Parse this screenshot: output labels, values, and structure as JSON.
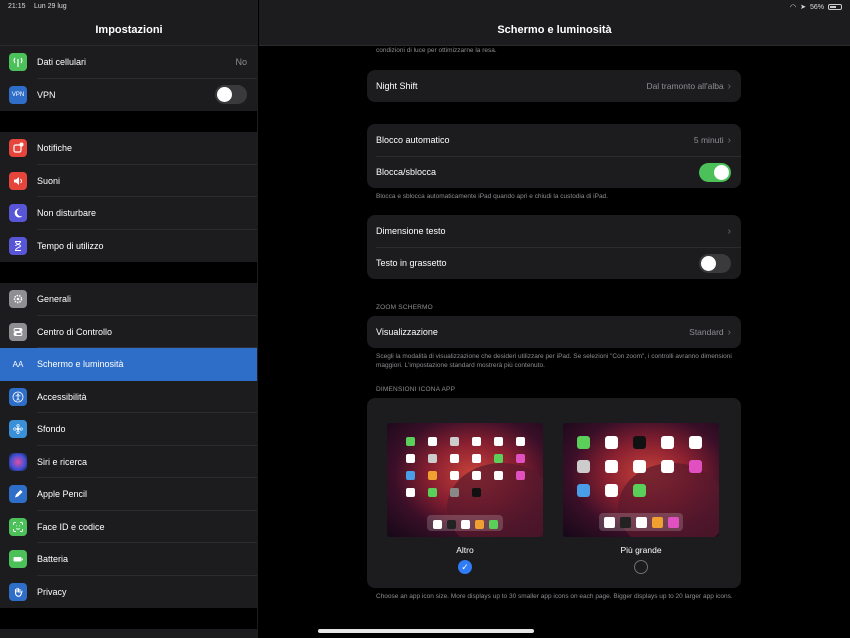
{
  "status": {
    "time": "21:15",
    "date": "Lun 29 lug",
    "battery": "56%"
  },
  "sidebar": {
    "title": "Impostazioni",
    "group1": [
      {
        "label": "Dati cellulari",
        "value": "No",
        "icon": "antenna-icon",
        "color": "#4cc15a"
      },
      {
        "label": "VPN",
        "icon": "vpn-icon",
        "color": "#2f6ec8",
        "toggle": false
      }
    ],
    "group2": [
      {
        "label": "Notifiche",
        "icon": "bell-icon",
        "color": "#e5453a"
      },
      {
        "label": "Suoni",
        "icon": "speaker-icon",
        "color": "#e5453a"
      },
      {
        "label": "Non disturbare",
        "icon": "moon-icon",
        "color": "#5856d6"
      },
      {
        "label": "Tempo di utilizzo",
        "icon": "hourglass-icon",
        "color": "#5856d6"
      }
    ],
    "group3": [
      {
        "label": "Generali",
        "icon": "gear-icon",
        "color": "#8e8e93"
      },
      {
        "label": "Centro di Controllo",
        "icon": "switches-icon",
        "color": "#8e8e93"
      },
      {
        "label": "Schermo e luminosità",
        "icon": "text-size-icon",
        "color": "#2f6ec8",
        "selected": true
      },
      {
        "label": "Accessibilità",
        "icon": "accessibility-icon",
        "color": "#2f6ec8"
      },
      {
        "label": "Sfondo",
        "icon": "flower-icon",
        "color": "#3a8fd9"
      },
      {
        "label": "Siri e ricerca",
        "icon": "siri-icon",
        "color": "#222"
      },
      {
        "label": "Apple Pencil",
        "icon": "pencil-icon",
        "color": "#2f6ec8"
      },
      {
        "label": "Face ID e codice",
        "icon": "face-id-icon",
        "color": "#4cc15a"
      },
      {
        "label": "Batteria",
        "icon": "battery-icon",
        "color": "#4cc15a"
      },
      {
        "label": "Privacy",
        "icon": "hand-icon",
        "color": "#2f6ec8"
      }
    ]
  },
  "detail": {
    "title": "Schermo e luminosità",
    "top_note": "condizioni di luce per ottimizzarne la resa.",
    "night_shift": {
      "label": "Night Shift",
      "value": "Dal tramonto all'alba"
    },
    "lock": {
      "auto_label": "Blocco automatico",
      "auto_value": "5 minuti",
      "lock_label": "Blocca/sblocca",
      "lock_on": true,
      "note": "Blocca e sblocca automaticamente iPad quando apri e chiudi la custodia di iPad."
    },
    "text": {
      "size_label": "Dimensione testo",
      "bold_label": "Testo in grassetto",
      "bold_on": false
    },
    "zoom": {
      "section": "ZOOM SCHERMO",
      "view_label": "Visualizzazione",
      "view_value": "Standard",
      "note": "Scegli la modalità di visualizzazione che desideri utilizzare per iPad. Se selezioni \"Con zoom\", i controlli avranno dimensioni maggiori. L'impostazione standard mostrerà più contenuto."
    },
    "icon_size": {
      "section": "DIMENSIONI ICONA APP",
      "option1": "Altro",
      "option2": "Più grande",
      "selected": "Altro",
      "note": "Choose an app icon size. More displays up to 30 smaller app icons on each page. Bigger displays up to 20 larger app icons."
    }
  }
}
